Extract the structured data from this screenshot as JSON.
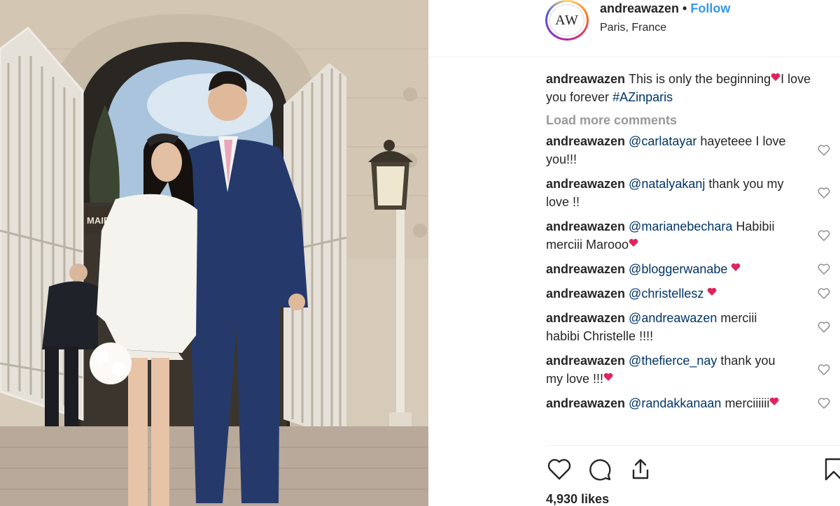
{
  "post": {
    "username": "andreawazen",
    "separator": "•",
    "follow_label": "Follow",
    "location": "Paris, France",
    "avatar_text": "AW",
    "building_sign": "MAIR",
    "caption": {
      "username": "andreawazen",
      "text_1": "This is only the beginning",
      "text_2": "I love you forever",
      "hashtag": "#AZinparis"
    },
    "load_more_label": "Load more comments",
    "comments": [
      {
        "username": "andreawazen",
        "mention": "@carlatayar",
        "text": "hayeteee I love you!!!",
        "emoji": ""
      },
      {
        "username": "andreawazen",
        "mention": "@natalyakanj",
        "text": "thank you my love !!",
        "emoji": ""
      },
      {
        "username": "andreawazen",
        "mention": "@marianebechara",
        "text": "Habibii merciii Marooo",
        "emoji": "heart"
      },
      {
        "username": "andreawazen",
        "mention": "@bloggerwanabe",
        "text": "",
        "emoji": "heart"
      },
      {
        "username": "andreawazen",
        "mention": "@christellesz",
        "text": "",
        "emoji": "heart"
      },
      {
        "username": "andreawazen",
        "mention": "@andreawazen",
        "text": "merciii habibi Christelle !!!!",
        "emoji": ""
      },
      {
        "username": "andreawazen",
        "mention": "@thefierce_nay",
        "text": "thank you my love !!!",
        "emoji": "heart"
      },
      {
        "username": "andreawazen",
        "mention": "@randakkanaan",
        "text": "merciiiiii",
        "emoji": "heart"
      }
    ],
    "likes_label": "4,930 likes",
    "icons": {
      "like": "heart-outline-icon",
      "comment": "speech-bubble-icon",
      "share": "share-upload-icon",
      "save": "bookmark-icon",
      "comment_like": "small-heart-outline-icon"
    },
    "colors": {
      "link": "#3897f0",
      "mention": "#003569",
      "muted": "#999999",
      "text": "#262626",
      "emoji_heart": "#e0245e"
    }
  }
}
